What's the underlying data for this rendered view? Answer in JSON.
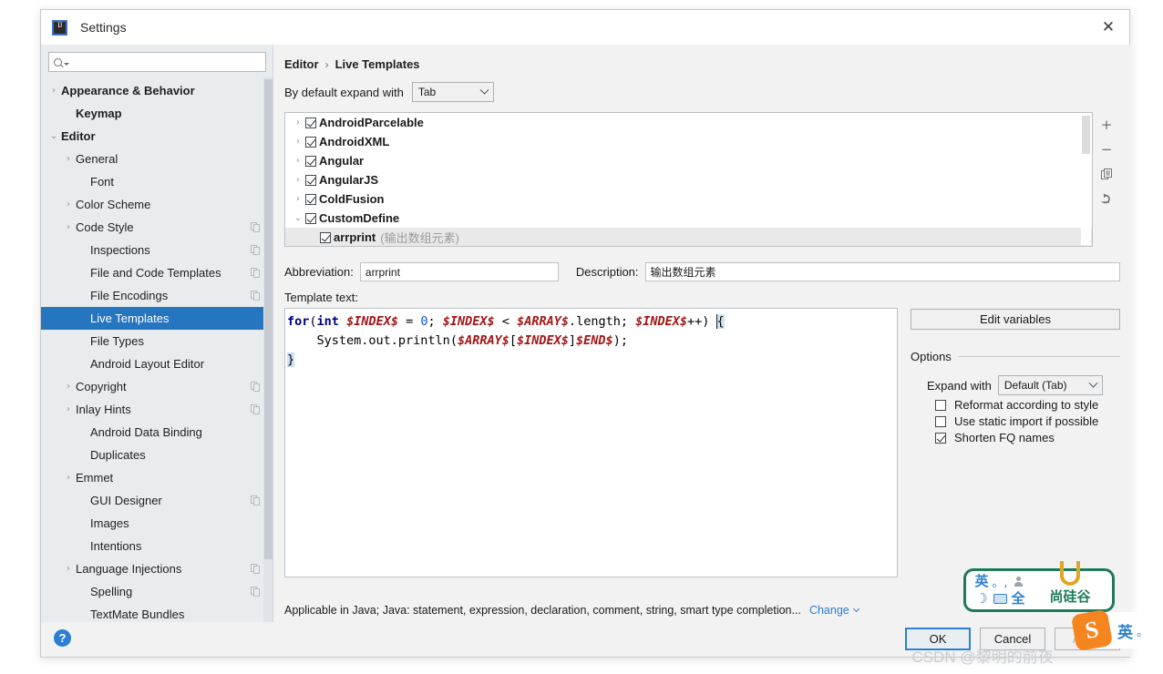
{
  "window": {
    "title": "Settings",
    "app_icon": "intellij-idea-icon",
    "close_icon": "close-icon"
  },
  "search": {
    "value": "",
    "placeholder": "",
    "icon": "search-icon"
  },
  "sidebar": {
    "items": [
      {
        "label": "Appearance & Behavior",
        "arrow": "›",
        "indent": 0,
        "bold": true,
        "selected": false,
        "copy": false
      },
      {
        "label": "Keymap",
        "arrow": "",
        "indent": 1,
        "bold": true,
        "selected": false,
        "copy": false
      },
      {
        "label": "Editor",
        "arrow": "⌄",
        "indent": 0,
        "bold": true,
        "selected": false,
        "copy": false
      },
      {
        "label": "General",
        "arrow": "›",
        "indent": 1,
        "bold": false,
        "selected": false,
        "copy": false
      },
      {
        "label": "Font",
        "arrow": "",
        "indent": 2,
        "bold": false,
        "selected": false,
        "copy": false
      },
      {
        "label": "Color Scheme",
        "arrow": "›",
        "indent": 1,
        "bold": false,
        "selected": false,
        "copy": false
      },
      {
        "label": "Code Style",
        "arrow": "›",
        "indent": 1,
        "bold": false,
        "selected": false,
        "copy": true
      },
      {
        "label": "Inspections",
        "arrow": "",
        "indent": 2,
        "bold": false,
        "selected": false,
        "copy": true
      },
      {
        "label": "File and Code Templates",
        "arrow": "",
        "indent": 2,
        "bold": false,
        "selected": false,
        "copy": true
      },
      {
        "label": "File Encodings",
        "arrow": "",
        "indent": 2,
        "bold": false,
        "selected": false,
        "copy": true
      },
      {
        "label": "Live Templates",
        "arrow": "",
        "indent": 2,
        "bold": false,
        "selected": true,
        "copy": false
      },
      {
        "label": "File Types",
        "arrow": "",
        "indent": 2,
        "bold": false,
        "selected": false,
        "copy": false
      },
      {
        "label": "Android Layout Editor",
        "arrow": "",
        "indent": 2,
        "bold": false,
        "selected": false,
        "copy": false
      },
      {
        "label": "Copyright",
        "arrow": "›",
        "indent": 1,
        "bold": false,
        "selected": false,
        "copy": true
      },
      {
        "label": "Inlay Hints",
        "arrow": "›",
        "indent": 1,
        "bold": false,
        "selected": false,
        "copy": true
      },
      {
        "label": "Android Data Binding",
        "arrow": "",
        "indent": 2,
        "bold": false,
        "selected": false,
        "copy": false
      },
      {
        "label": "Duplicates",
        "arrow": "",
        "indent": 2,
        "bold": false,
        "selected": false,
        "copy": false
      },
      {
        "label": "Emmet",
        "arrow": "›",
        "indent": 1,
        "bold": false,
        "selected": false,
        "copy": false
      },
      {
        "label": "GUI Designer",
        "arrow": "",
        "indent": 2,
        "bold": false,
        "selected": false,
        "copy": true
      },
      {
        "label": "Images",
        "arrow": "",
        "indent": 2,
        "bold": false,
        "selected": false,
        "copy": false
      },
      {
        "label": "Intentions",
        "arrow": "",
        "indent": 2,
        "bold": false,
        "selected": false,
        "copy": false
      },
      {
        "label": "Language Injections",
        "arrow": "›",
        "indent": 1,
        "bold": false,
        "selected": false,
        "copy": true
      },
      {
        "label": "Spelling",
        "arrow": "",
        "indent": 2,
        "bold": false,
        "selected": false,
        "copy": true
      },
      {
        "label": "TextMate Bundles",
        "arrow": "",
        "indent": 2,
        "bold": false,
        "selected": false,
        "copy": false
      }
    ]
  },
  "breadcrumb": {
    "parent": "Editor",
    "separator": "›",
    "current": "Live Templates"
  },
  "expand_default": {
    "label": "By default expand with",
    "value": "Tab"
  },
  "templates": {
    "rows": [
      {
        "tri": "›",
        "name": "AndroidParcelable",
        "desc": "",
        "checked": true,
        "child": false,
        "selected": false
      },
      {
        "tri": "›",
        "name": "AndroidXML",
        "desc": "",
        "checked": true,
        "child": false,
        "selected": false
      },
      {
        "tri": "›",
        "name": "Angular",
        "desc": "",
        "checked": true,
        "child": false,
        "selected": false
      },
      {
        "tri": "›",
        "name": "AngularJS",
        "desc": "",
        "checked": true,
        "child": false,
        "selected": false
      },
      {
        "tri": "›",
        "name": "ColdFusion",
        "desc": "",
        "checked": true,
        "child": false,
        "selected": false
      },
      {
        "tri": "⌄",
        "name": "CustomDefine",
        "desc": "",
        "checked": true,
        "child": false,
        "selected": false
      },
      {
        "tri": "",
        "name": "arrprint",
        "desc": "(输出数组元素)",
        "checked": true,
        "child": true,
        "selected": true
      }
    ],
    "toolbar": [
      {
        "icon": "add-icon",
        "glyph": "+"
      },
      {
        "icon": "remove-icon",
        "glyph": "−"
      },
      {
        "icon": "copy-icon",
        "glyph": ""
      },
      {
        "icon": "revert-icon",
        "glyph": "↶"
      }
    ]
  },
  "fields": {
    "abbreviation_label": "Abbreviation:",
    "abbreviation_value": "arrprint",
    "description_label": "Description:",
    "description_value": "输出数组元素",
    "template_text_label": "Template text:"
  },
  "code": {
    "line1": {
      "kw_for": "for",
      "paren_open": "(",
      "kw_int": "int",
      "v_index_1": "$INDEX$",
      "eq": " = ",
      "zero": "0",
      "semi1": "; ",
      "v_index_2": "$INDEX$",
      "lt": " < ",
      "v_array": "$ARRAY$",
      "dot_length": ".length; ",
      "v_index_3": "$INDEX$",
      "plusplus": "++) ",
      "brace_open": "{"
    },
    "line2": {
      "indent": "    ",
      "call": "System.out.println(",
      "v_array": "$ARRAY$",
      "bracket_open": "[",
      "v_index": "$INDEX$",
      "bracket_close": "]",
      "v_end": "$END$",
      "tail": ");"
    },
    "line3": {
      "brace_close": "}"
    }
  },
  "options": {
    "edit_variables_label": "Edit variables",
    "group_label": "Options",
    "expand_with_label": "Expand with",
    "expand_with_value": "Default (Tab)",
    "checkboxes": [
      {
        "label": "Reformat according to style",
        "checked": false
      },
      {
        "label": "Use static import if possible",
        "checked": false
      },
      {
        "label": "Shorten FQ names",
        "checked": true
      }
    ]
  },
  "applicable": {
    "text": "Applicable in Java; Java: statement, expression, declaration, comment, string, smart type completion...",
    "change_label": "Change"
  },
  "footer": {
    "help_icon": "help-icon",
    "help_glyph": "?",
    "buttons": [
      {
        "label": "OK",
        "style": "default",
        "enabled": true
      },
      {
        "label": "Cancel",
        "style": "normal",
        "enabled": true
      },
      {
        "label": "Apply",
        "style": "disabled",
        "enabled": false
      }
    ]
  },
  "ime_bar": {
    "mode_glyph": "英",
    "punct_glyph": "。,",
    "user_icon": "user-icon",
    "moon_glyph": "☽",
    "keyboard_icon": "keyboard-icon",
    "full_width_glyph": "全",
    "brand": "尚硅谷",
    "logo": "u-logo"
  },
  "sogou_bar": {
    "logo_glyph": "S",
    "mode_glyph": "英",
    "punct_glyph": "。"
  },
  "watermark": {
    "text": "CSDN @黎明的前夜"
  },
  "colors": {
    "accent": "#2675bf",
    "link": "#2e7dd1",
    "keyword": "#000080",
    "variable": "#a31515",
    "number": "#1750eb",
    "brand_green": "#1e7a5a",
    "sogou_orange": "#f7851f"
  }
}
